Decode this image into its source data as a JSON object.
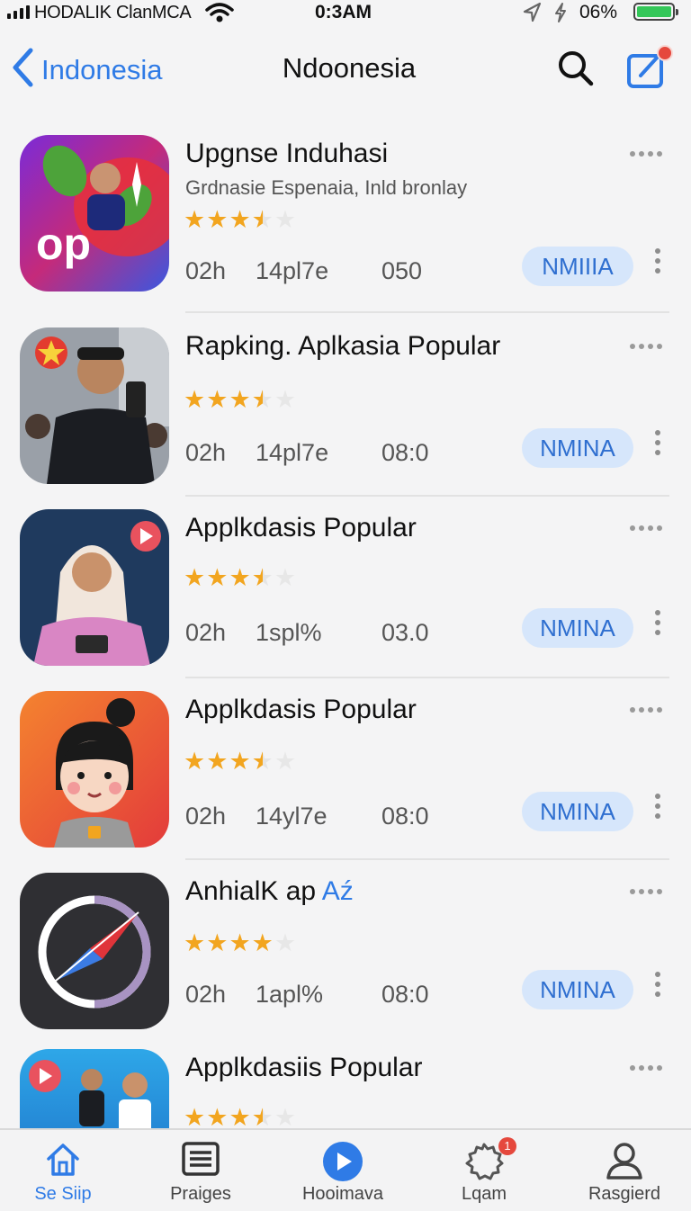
{
  "status_bar": {
    "carrier": "HODALIK ClanMCA",
    "time": "0:3AM",
    "battery": "06%"
  },
  "nav": {
    "back_label": "Indonesia",
    "title": "Ndoonesia"
  },
  "apps": [
    {
      "title": "Upgnse Induhasi",
      "subtitle": "Grdnasie Espenaia, Inld bronlay",
      "icon_text": "op",
      "rating": 3.5,
      "size": "02h",
      "meta2": "14pl7e",
      "meta3": "050",
      "button": "NMIIIA"
    },
    {
      "title": "Rapking. Aplkasia Popular",
      "rating": 3.5,
      "size": "02h",
      "meta2": "14pl7e",
      "meta3": "08:0",
      "button": "NMINA"
    },
    {
      "title": "Applkdasis Popular",
      "rating": 3.5,
      "size": "02h",
      "meta2": "1spl%",
      "meta3": "03.0",
      "button": "NMINA"
    },
    {
      "title": "Applkdasis Popular",
      "rating": 3.5,
      "size": "02h",
      "meta2": "14yl7e",
      "meta3": "08:0",
      "button": "NMINA"
    },
    {
      "title": "AnhialK ap",
      "title_accent": "Aź",
      "rating": 4.5,
      "size": "02h",
      "meta2": "1apl%",
      "meta3": "08:0",
      "button": "NMINA"
    },
    {
      "title": "Applkdasiis Popular",
      "rating": 3.5
    }
  ],
  "tabs": [
    {
      "label": "Se Siip",
      "icon": "home-icon",
      "active": true
    },
    {
      "label": "Praiges",
      "icon": "list-icon"
    },
    {
      "label": "Hooimava",
      "icon": "play-icon"
    },
    {
      "label": "Lqam",
      "icon": "gear-icon",
      "badge": "1"
    },
    {
      "label": "Rasgierd",
      "icon": "person-icon"
    }
  ],
  "colors": {
    "accent": "#2f7be6",
    "button_bg": "#d6e6fb",
    "star": "#f2a51f",
    "badge": "#e5483d",
    "battery": "#34c759"
  }
}
